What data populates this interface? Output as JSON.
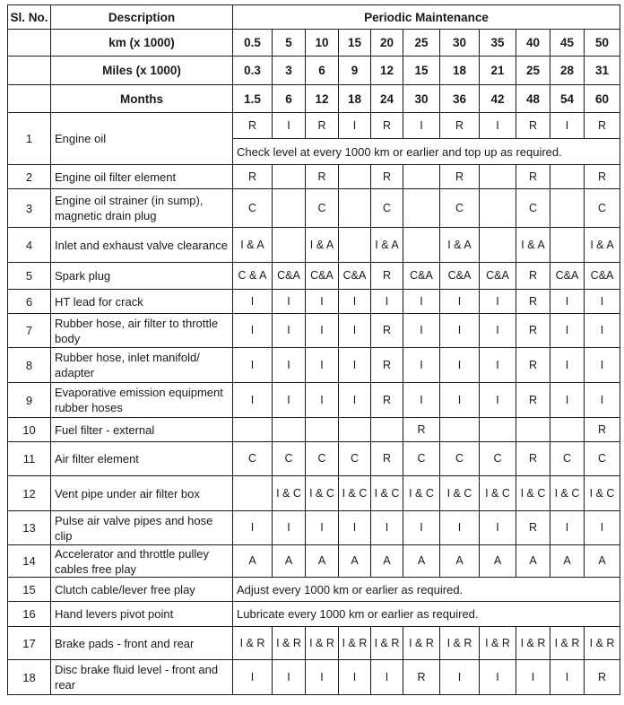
{
  "header": {
    "sl_no": "Sl. No.",
    "description": "Description",
    "periodic": "Periodic Maintenance",
    "km_label": "km (x 1000)",
    "miles_label": "Miles (x 1000)",
    "months_label": "Months",
    "km": [
      "0.5",
      "5",
      "10",
      "15",
      "20",
      "25",
      "30",
      "35",
      "40",
      "45",
      "50"
    ],
    "miles": [
      "0.3",
      "3",
      "6",
      "9",
      "12",
      "15",
      "18",
      "21",
      "25",
      "28",
      "31"
    ],
    "months": [
      "1.5",
      "6",
      "12",
      "18",
      "24",
      "30",
      "36",
      "42",
      "48",
      "54",
      "60"
    ]
  },
  "rows": [
    {
      "no": "1",
      "desc": "Engine oil",
      "values": [
        "R",
        "I",
        "R",
        "I",
        "R",
        "I",
        "R",
        "I",
        "R",
        "I",
        "R"
      ],
      "note": "Check level at every 1000 km or earlier and top up as required."
    },
    {
      "no": "2",
      "desc": "Engine oil filter element",
      "values": [
        "R",
        "",
        "R",
        "",
        "R",
        "",
        "R",
        "",
        "R",
        "",
        "R"
      ]
    },
    {
      "no": "3",
      "desc": "Engine oil strainer (in sump), magnetic drain plug",
      "values": [
        "C",
        "",
        "C",
        "",
        "C",
        "",
        "C",
        "",
        "C",
        "",
        "C"
      ]
    },
    {
      "no": "4",
      "desc": "Inlet and exhaust valve clearance",
      "values": [
        "I & A",
        "",
        "I & A",
        "",
        "I & A",
        "",
        "I & A",
        "",
        "I & A",
        "",
        "I & A"
      ]
    },
    {
      "no": "5",
      "desc": "Spark plug",
      "values": [
        "C & A",
        "C&A",
        "C&A",
        "C&A",
        "R",
        "C&A",
        "C&A",
        "C&A",
        "R",
        "C&A",
        "C&A"
      ]
    },
    {
      "no": "6",
      "desc": "HT lead for crack",
      "values": [
        "I",
        "I",
        "I",
        "I",
        "I",
        "I",
        "I",
        "I",
        "R",
        "I",
        "I"
      ]
    },
    {
      "no": "7",
      "desc": "Rubber hose, air filter to throttle body",
      "values": [
        "I",
        "I",
        "I",
        "I",
        "R",
        "I",
        "I",
        "I",
        "R",
        "I",
        "I"
      ]
    },
    {
      "no": "8",
      "desc": "Rubber hose, inlet manifold/ adapter",
      "values": [
        "I",
        "I",
        "I",
        "I",
        "R",
        "I",
        "I",
        "I",
        "R",
        "I",
        "I"
      ]
    },
    {
      "no": "9",
      "desc": "Evaporative emission equipment rubber hoses",
      "values": [
        "I",
        "I",
        "I",
        "I",
        "R",
        "I",
        "I",
        "I",
        "R",
        "I",
        "I"
      ]
    },
    {
      "no": "10",
      "desc": "Fuel filter - external",
      "values": [
        "",
        "",
        "",
        "",
        "",
        "R",
        "",
        "",
        "",
        "",
        "R"
      ]
    },
    {
      "no": "11",
      "desc": "Air filter element",
      "values": [
        "C",
        "C",
        "C",
        "C",
        "R",
        "C",
        "C",
        "C",
        "R",
        "C",
        "C"
      ]
    },
    {
      "no": "12",
      "desc": "Vent pipe under air filter box",
      "values": [
        "",
        "I & C",
        "I & C",
        "I & C",
        "I & C",
        "I & C",
        "I & C",
        "I & C",
        "I & C",
        "I & C",
        "I & C"
      ]
    },
    {
      "no": "13",
      "desc": "Pulse air valve pipes and hose clip",
      "values": [
        "I",
        "I",
        "I",
        "I",
        "I",
        "I",
        "I",
        "I",
        "R",
        "I",
        "I"
      ]
    },
    {
      "no": "14",
      "desc": "Accelerator and throttle pulley cables free play",
      "values": [
        "A",
        "A",
        "A",
        "A",
        "A",
        "A",
        "A",
        "A",
        "A",
        "A",
        "A"
      ]
    },
    {
      "no": "15",
      "desc": "Clutch cable/lever free play",
      "note": "Adjust every 1000 km or earlier as required."
    },
    {
      "no": "16",
      "desc": "Hand levers pivot point",
      "note": "Lubricate every 1000 km or earlier as required."
    },
    {
      "no": "17",
      "desc": "Brake pads - front and rear",
      "values": [
        "I & R",
        "I & R",
        "I & R",
        "I & R",
        "I & R",
        "I & R",
        "I & R",
        "I & R",
        "I & R",
        "I & R",
        "I & R"
      ]
    },
    {
      "no": "18",
      "desc": "Disc brake fluid level - front and rear",
      "values": [
        "I",
        "I",
        "I",
        "I",
        "I",
        "R",
        "I",
        "I",
        "I",
        "I",
        "R"
      ]
    }
  ]
}
